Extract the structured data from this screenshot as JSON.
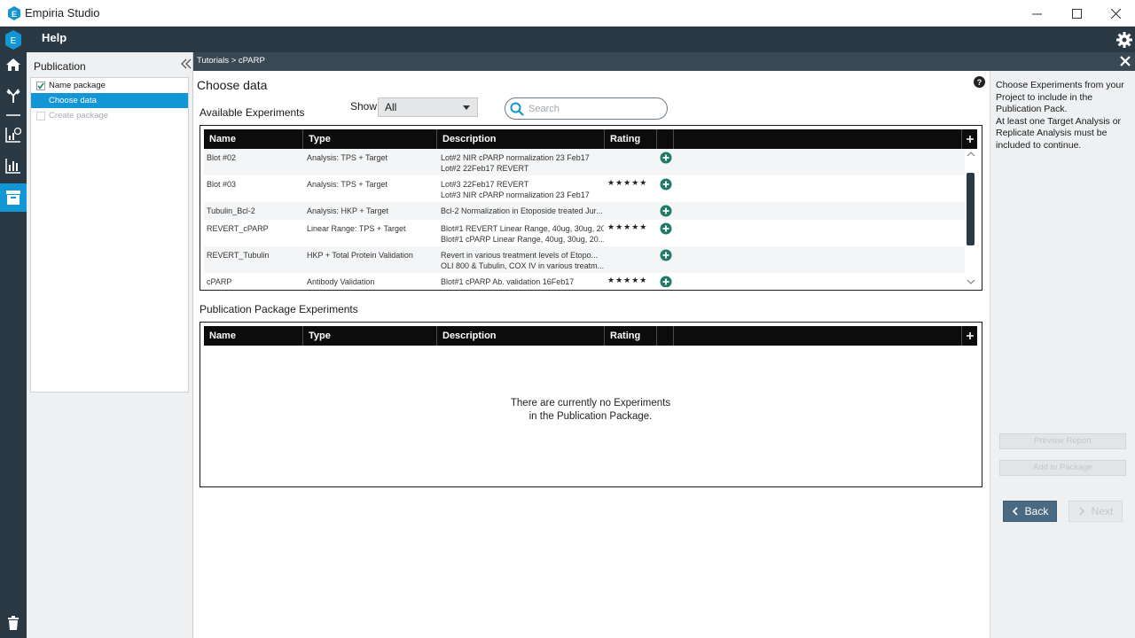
{
  "window": {
    "title": "Empiria Studio"
  },
  "topbar": {
    "help_label": "Help"
  },
  "workflow": {
    "title": "Publication",
    "steps": [
      {
        "label": "Name package",
        "state": "done"
      },
      {
        "label": "Choose data",
        "state": "active"
      },
      {
        "label": "Create package",
        "state": "disabled"
      }
    ]
  },
  "breadcrumb": {
    "text": "Tutorials > cPARP"
  },
  "main": {
    "page_title": "Choose data",
    "available_title": "Available Experiments",
    "show_label": "Show",
    "show_value": "All",
    "search_placeholder": "Search",
    "columns": [
      "Name",
      "Type",
      "Description",
      "Rating"
    ],
    "available_rows": [
      {
        "name": "Blot #02",
        "type": "Analysis: TPS + Target",
        "desc1": "Lot#2 NIR cPARP normalization 23 Feb17",
        "desc2": "Lot#2 22Feb17 REVERT",
        "rating": ""
      },
      {
        "name": "Blot #03",
        "type": "Analysis: TPS + Target",
        "desc1": "Lot#3 22Feb17 REVERT",
        "desc2": "Lot#3 NIR cPARP normalization 23 Feb17",
        "rating": "★★★★★"
      },
      {
        "name": "Tubulin_Bcl-2",
        "type": "Analysis: HKP + Target",
        "desc1": "Bcl-2 Normalization in Etoposide treated Jur...",
        "desc2": "",
        "rating": ""
      },
      {
        "name": "REVERT_cPARP",
        "type": "Linear Range: TPS + Target",
        "desc1": "Blot#1 REVERT Linear Range, 40ug, 30ug, 20...",
        "desc2": "Blot#1 cPARP Linear Range, 40ug, 30ug, 20...",
        "rating": "★★★★★"
      },
      {
        "name": "REVERT_Tubulin",
        "type": "HKP + Total Protein Validation",
        "desc1": "Revert  in various treatment levels of Etopo...",
        "desc2": "OLI 800 & Tubulin, COX IV in various treatm...",
        "rating": ""
      },
      {
        "name": "cPARP",
        "type": "Antibody Validation",
        "desc1": "Blot#1 cPARP Ab. validation 16Feb17",
        "desc2": "",
        "rating": "★★★★★"
      }
    ],
    "package_title": "Publication Package Experiments",
    "empty_line1": "There are currently no Experiments",
    "empty_line2": "in the Publication Package."
  },
  "rightpanel": {
    "info": "Choose Experiments from your Project to include in the Publication Pack.\nAt least one Target Analysis or Replicate Analysis must be included to continue.",
    "preview_label": "Preview Report",
    "add_label": "Add to Package",
    "back_label": "Back",
    "next_label": "Next"
  },
  "colors": {
    "accent": "#1296d4",
    "dark": "#2b3945",
    "add_green": "#1f7a68"
  }
}
